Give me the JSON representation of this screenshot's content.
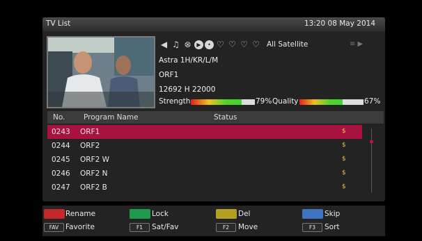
{
  "header": {
    "title": "TV List",
    "datetime": "13:20 08 May 2014"
  },
  "icons": [
    "arrow-left-icon",
    "music-note-icon",
    "globe-icon",
    "play-icon",
    "blank-icon",
    "heart-icon",
    "heart-icon",
    "heart-icon",
    "heart-icon"
  ],
  "satellite": {
    "filter_label": "All Satellite"
  },
  "info": {
    "satellite_name": "Astra 1H/KR/L/M",
    "channel": "ORF1",
    "frequency": "12692 H 22000",
    "strength_label": "Strength",
    "strength_value": "79%",
    "strength_level": 0.79,
    "quality_label": "Quality",
    "quality_value": "67%",
    "quality_level": 0.67
  },
  "table": {
    "headers": {
      "no": "No.",
      "name": "Program Name",
      "status": "Status"
    },
    "rows": [
      {
        "no": "0243",
        "name": "ORF1"
      },
      {
        "no": "0244",
        "name": "ORF2"
      },
      {
        "no": "0245",
        "name": "ORF2 W"
      },
      {
        "no": "0246",
        "name": "ORF2 N"
      },
      {
        "no": "0247",
        "name": "ORF2 B"
      }
    ],
    "status_marker": "$"
  },
  "footer": {
    "rename": "Rename",
    "lock": "Lock",
    "del": "Del",
    "skip": "Skip",
    "fav_key": "FAV",
    "favorite": "Favorite",
    "f1_key": "F1",
    "satfav": "Sat/Fav",
    "f2_key": "F2",
    "move": "Move",
    "f3_key": "F3",
    "sort": "Sort"
  },
  "colors": {
    "red": "#c4282a",
    "green": "#1f9a4c",
    "yellow": "#b3a020",
    "blue": "#3f73c2",
    "selected_row": "#a8123e"
  }
}
